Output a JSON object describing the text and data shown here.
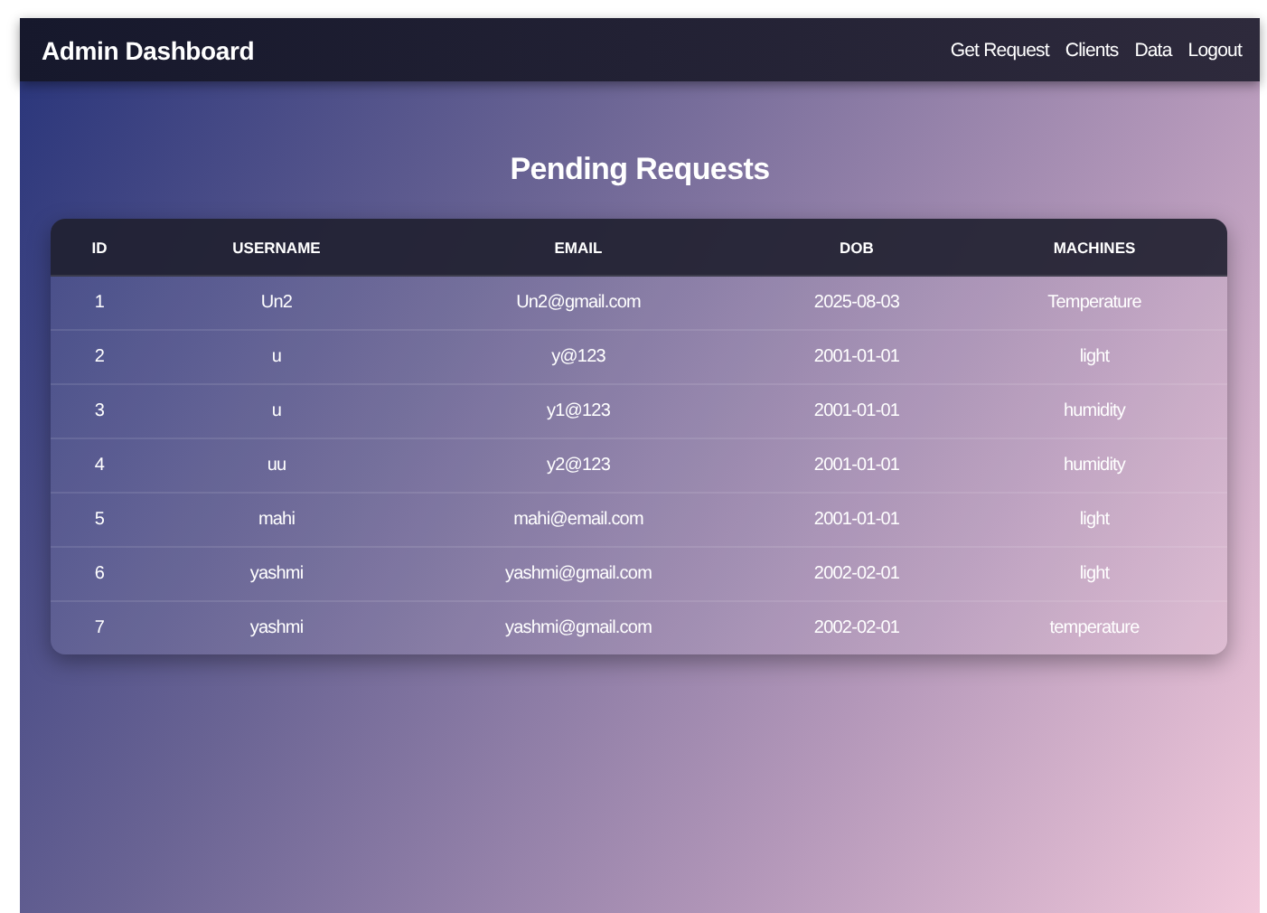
{
  "navbar": {
    "title": "Admin Dashboard",
    "links": [
      "Get Request",
      "Clients",
      "Data",
      "Logout"
    ]
  },
  "heading": "Pending Requests",
  "table": {
    "columns": [
      "ID",
      "USERNAME",
      "EMAIL",
      "DOB",
      "MACHINES"
    ],
    "rows": [
      [
        "1",
        "Un2",
        "Un2@gmail.com",
        "2025-08-03",
        "Temperature"
      ],
      [
        "2",
        "u",
        "y@123",
        "2001-01-01",
        "light"
      ],
      [
        "3",
        "u",
        "y1@123",
        "2001-01-01",
        "humidity"
      ],
      [
        "4",
        "uu",
        "y2@123",
        "2001-01-01",
        "humidity"
      ],
      [
        "5",
        "mahi",
        "mahi@email.com",
        "2001-01-01",
        "light"
      ],
      [
        "6",
        "yashmi",
        "yashmi@gmail.com",
        "2002-02-01",
        "light"
      ],
      [
        "7",
        "yashmi",
        "yashmi@gmail.com",
        "2002-02-01",
        "temperature"
      ]
    ]
  }
}
